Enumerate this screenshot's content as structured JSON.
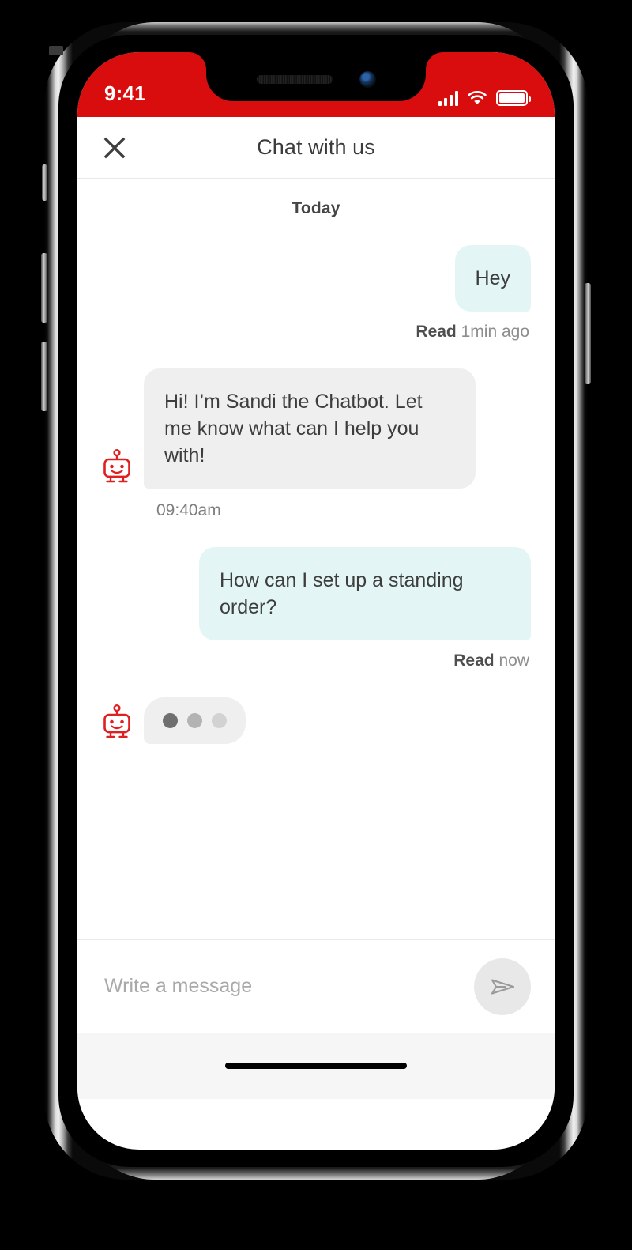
{
  "theme": {
    "brand_red": "#d90d0d",
    "outgoing_bubble": "#e3f6f5",
    "incoming_bubble": "#efefef",
    "avatar_color": "#e02020"
  },
  "status_bar": {
    "time": "9:41",
    "signal_icon": "cellular-bars-icon",
    "wifi_icon": "wifi-icon",
    "battery_icon": "battery-full-icon"
  },
  "header": {
    "title": "Chat with us",
    "close_icon": "close-icon"
  },
  "conversation": {
    "day_divider": "Today",
    "messages": [
      {
        "id": "msg-1",
        "direction": "outgoing",
        "text": "Hey",
        "status_label": "Read",
        "time_label": "1min ago"
      },
      {
        "id": "msg-2",
        "direction": "incoming",
        "text": "Hi! I’m Sandi the Chatbot. Let me know what can I help you with!",
        "time_label": "09:40am",
        "avatar_icon": "robot-avatar-icon"
      },
      {
        "id": "msg-3",
        "direction": "outgoing",
        "text": "How can I set up a standing order?",
        "status_label": "Read",
        "time_label": "now"
      },
      {
        "id": "msg-4",
        "direction": "incoming",
        "type": "typing-indicator",
        "avatar_icon": "robot-avatar-icon",
        "dots": 3
      }
    ]
  },
  "composer": {
    "placeholder": "Write a message",
    "value": "",
    "send_icon": "send-paper-plane-icon"
  },
  "device": {
    "speaker_icon": "earpiece-speaker-icon",
    "camera_icon": "front-camera-icon",
    "home_indicator": "home-indicator"
  }
}
